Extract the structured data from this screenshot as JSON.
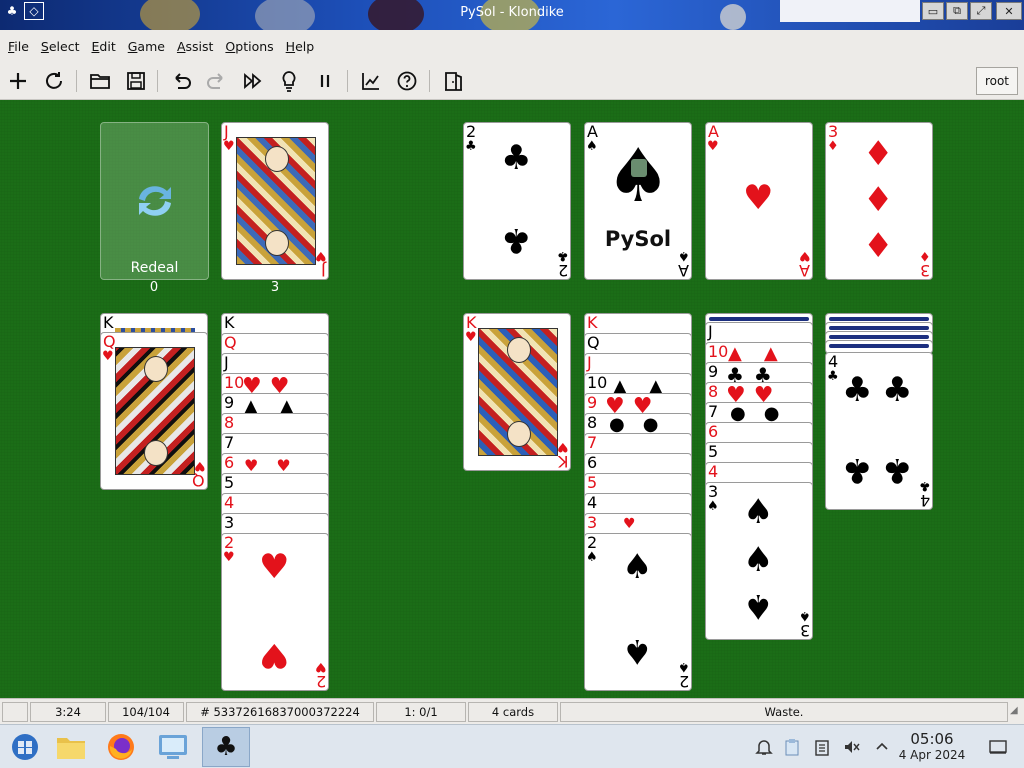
{
  "window": {
    "title": "PySol - Klondike"
  },
  "menu": {
    "items": [
      "File",
      "Select",
      "Edit",
      "Game",
      "Assist",
      "Options",
      "Help"
    ]
  },
  "toolbar": {
    "buttons": [
      "new-game",
      "restart",
      "open",
      "save",
      "undo",
      "redo",
      "autodrop",
      "hint",
      "pause",
      "statistics",
      "rules",
      "quit"
    ],
    "player": "root"
  },
  "talon": {
    "redeal_label": "Redeal",
    "count": "0"
  },
  "waste": {
    "count": "3",
    "top_card": {
      "rank": "J",
      "suit": "♥"
    }
  },
  "foundations": [
    {
      "rank": "2",
      "suit": "♣"
    },
    {
      "rank": "A",
      "suit": "♠",
      "brand": "PySol"
    },
    {
      "rank": "A",
      "suit": "♥"
    },
    {
      "rank": "3",
      "suit": "♦"
    }
  ],
  "tableau": [
    {
      "cards": [
        {
          "rank": "K",
          "suit": ""
        },
        {
          "rank": "Q",
          "suit": "♥"
        }
      ]
    },
    {
      "cards": [
        {
          "rank": "K",
          "suit": ""
        },
        {
          "rank": "Q",
          "suit": ""
        },
        {
          "rank": "J",
          "suit": ""
        },
        {
          "rank": "10",
          "suit": ""
        },
        {
          "rank": "9",
          "suit": ""
        },
        {
          "rank": "8",
          "suit": ""
        },
        {
          "rank": "7",
          "suit": ""
        },
        {
          "rank": "6",
          "suit": ""
        },
        {
          "rank": "5",
          "suit": ""
        },
        {
          "rank": "4",
          "suit": ""
        },
        {
          "rank": "3",
          "suit": ""
        },
        {
          "rank": "2",
          "suit": "♥"
        }
      ]
    },
    {
      "cards": [
        {
          "rank": "K",
          "suit": "♥"
        }
      ]
    },
    {
      "cards": [
        {
          "rank": "K",
          "suit": ""
        },
        {
          "rank": "Q",
          "suit": ""
        },
        {
          "rank": "J",
          "suit": ""
        },
        {
          "rank": "10",
          "suit": ""
        },
        {
          "rank": "9",
          "suit": ""
        },
        {
          "rank": "8",
          "suit": ""
        },
        {
          "rank": "7",
          "suit": ""
        },
        {
          "rank": "6",
          "suit": ""
        },
        {
          "rank": "5",
          "suit": ""
        },
        {
          "rank": "4",
          "suit": ""
        },
        {
          "rank": "3",
          "suit": ""
        },
        {
          "rank": "2",
          "suit": "♠"
        }
      ]
    },
    {
      "cards": [
        {
          "rank": "J",
          "suit": ""
        },
        {
          "rank": "10",
          "suit": ""
        },
        {
          "rank": "9",
          "suit": ""
        },
        {
          "rank": "8",
          "suit": ""
        },
        {
          "rank": "7",
          "suit": ""
        },
        {
          "rank": "6",
          "suit": ""
        },
        {
          "rank": "5",
          "suit": ""
        },
        {
          "rank": "4",
          "suit": ""
        },
        {
          "rank": "3",
          "suit": "♠"
        }
      ]
    },
    {
      "cards": [
        {
          "rank": "4",
          "suit": "♣"
        }
      ]
    }
  ],
  "status": {
    "time": "3:24",
    "cards_progress": "104/104",
    "game_number": "# 53372616837000372224",
    "moves": "1: 0/1",
    "cards_left": "4 cards",
    "message": "Waste."
  },
  "taskbar": {
    "clock_time": "05:06",
    "clock_date": "4 Apr 2024",
    "apps": [
      "start-menu",
      "file-manager",
      "firefox",
      "system-settings",
      "pysol"
    ]
  },
  "colors": {
    "table": "#1b6d17",
    "red_suit": "#e3121b",
    "black_suit": "#000000"
  }
}
